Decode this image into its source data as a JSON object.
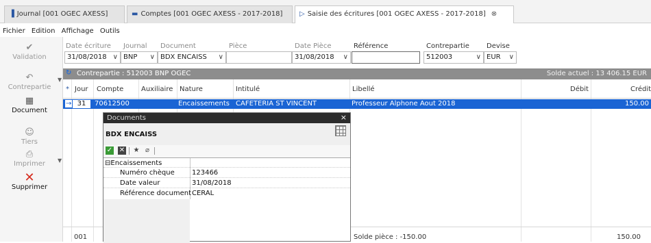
{
  "tabs": [
    {
      "label": "Journal [001 OGEC    AXESS]",
      "icon": "journal-icon"
    },
    {
      "label": "Comptes [001 OGEC    AXESS - 2017-2018]",
      "icon": "comptes-icon"
    },
    {
      "label": "Saisie des écritures [001 OGEC    AXESS - 2017-2018]",
      "icon": "saisie-icon"
    }
  ],
  "menu": [
    "Fichier",
    "Edition",
    "Affichage",
    "Outils"
  ],
  "toolbar": {
    "validation": "Validation",
    "contrepartie": "Contrepartie",
    "document": "Document",
    "tiers": "Tiers",
    "imprimer": "Imprimer",
    "supprimer": "Supprimer"
  },
  "fields": {
    "date_ecriture_label": "Date écriture",
    "date_ecriture": "31/08/2018",
    "journal_label": "Journal",
    "journal": "BNP",
    "document_label": "Document",
    "document": "BDX ENCAISS",
    "piece_label": "Pièce",
    "piece": "",
    "date_piece_label": "Date Pièce",
    "date_piece": "31/08/2018",
    "reference_label": "Référence",
    "reference": "",
    "contrepartie_label": "Contrepartie",
    "contrepartie": "512003",
    "devise_label": "Devise",
    "devise": "EUR"
  },
  "contrepartie_bar": {
    "text": "Contrepartie : 512003 BNP OGEC",
    "solde": "Solde actuel : 13 406.15 EUR"
  },
  "grid": {
    "headers": {
      "star": "*",
      "jour": "Jour",
      "compte": "Compte",
      "auxiliaire": "Auxiliaire",
      "nature": "Nature",
      "intitule": "Intitulé",
      "libelle": "Libellé",
      "debit": "Débit",
      "credit": "Crédit"
    },
    "row": {
      "marker": "→",
      "jour": "31",
      "compte": "70612500",
      "nature": "Encaissements",
      "intitule": "CAFETERIA ST VINCENT",
      "libelle": "Professeur Alphone Aout 2018",
      "credit": "150.00"
    },
    "footer": {
      "count": "001",
      "solde_piece": "Solde pièce : -150.00",
      "credit_total": "150.00"
    }
  },
  "dialog": {
    "title": "Documents",
    "close": "×",
    "header": "BDX ENCAISS",
    "section": "⊟Encaissements",
    "props": [
      {
        "key": "Numéro chèque",
        "value": "123466"
      },
      {
        "key": "Date valeur",
        "value": "31/08/2018"
      },
      {
        "key": "Référence document",
        "value": "CERAL"
      }
    ]
  },
  "colors": {
    "selection": "#1a64d4",
    "contrepartie_bar": "#8d8d8d",
    "dialog_title": "#2c2c2c",
    "delete_icon": "#d52b1e",
    "ok_button": "#3a9b36"
  }
}
